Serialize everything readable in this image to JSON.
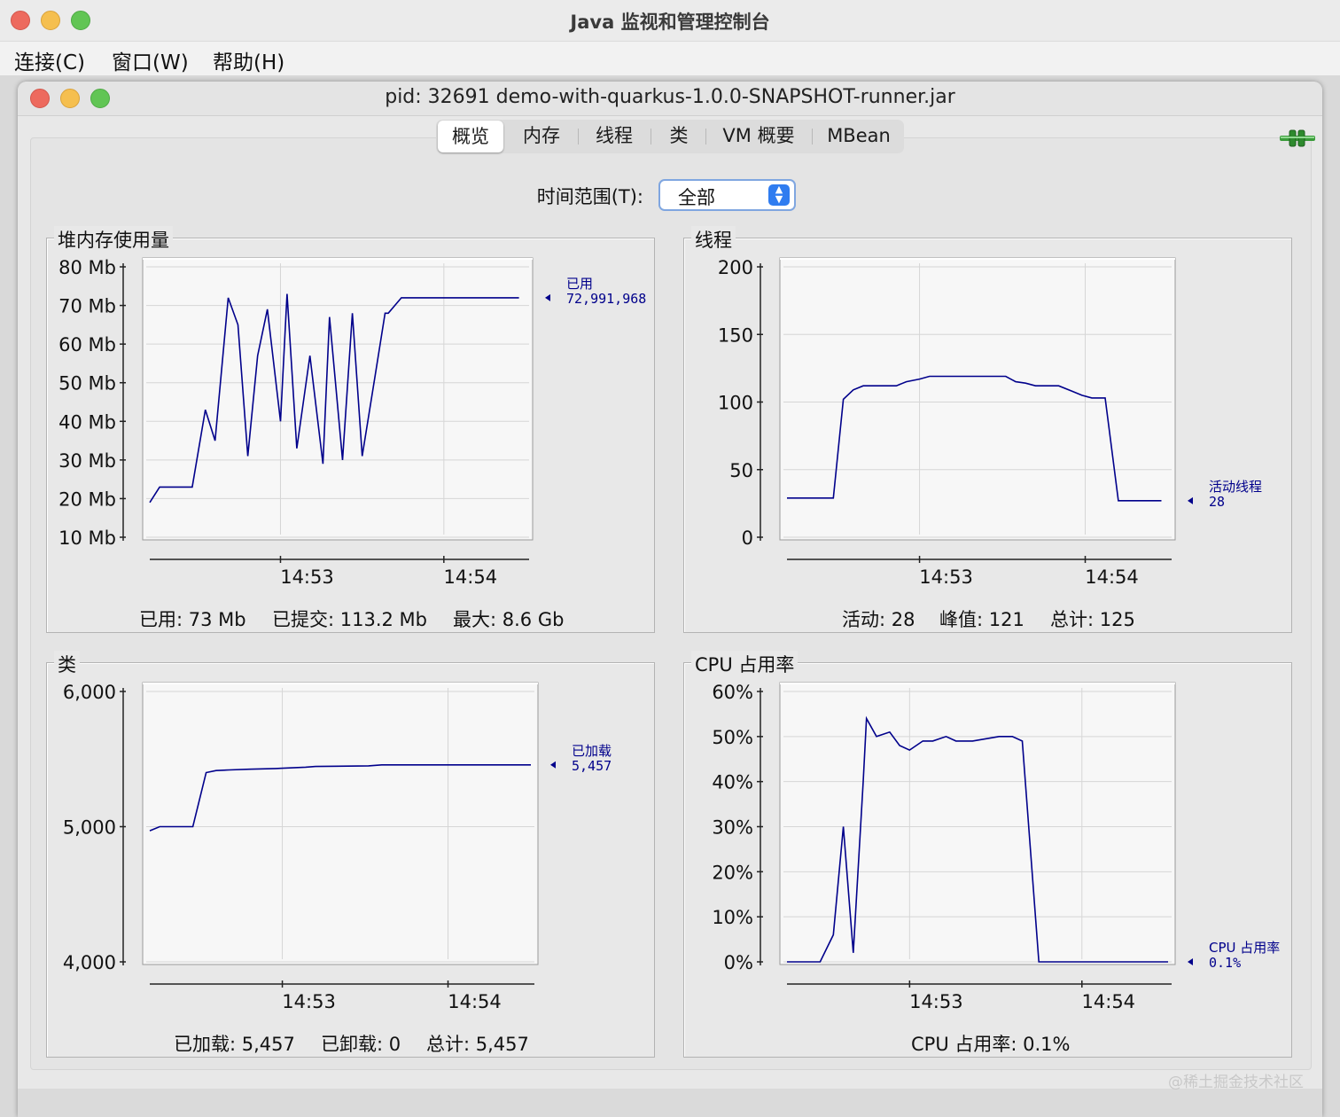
{
  "window": {
    "app_title": "Java 监视和管理控制台",
    "inner_title": "pid: 32691 demo-with-quarkus-1.0.0-SNAPSHOT-runner.jar"
  },
  "menubar": {
    "items": [
      "连接(C)",
      "窗口(W)",
      "帮助(H)"
    ]
  },
  "tabs": [
    {
      "label": "概览",
      "active": true
    },
    {
      "label": "内存",
      "active": false
    },
    {
      "label": "线程",
      "active": false
    },
    {
      "label": "类",
      "active": false
    },
    {
      "label": "VM 概要",
      "active": false
    },
    {
      "label": "MBean",
      "active": false
    }
  ],
  "time_range": {
    "label": "时间范围(T):",
    "value": "全部"
  },
  "icons": {
    "connection": "connection-plug-icon",
    "select_stepper": "stepper-arrows-icon"
  },
  "colors": {
    "series": "#00008b",
    "accent": "#2f7cf0"
  },
  "panels": {
    "heap": {
      "title": "堆内存使用量",
      "summary": [
        "已用: 73 Mb",
        "已提交: 113.2 Mb",
        "最大: 8.6 Gb"
      ]
    },
    "threads": {
      "title": "线程",
      "summary": [
        "活动: 28",
        "峰值: 121",
        "总计: 125"
      ]
    },
    "classes": {
      "title": "类",
      "summary": [
        "已加载: 5,457",
        "已卸载: 0",
        "总计: 5,457"
      ]
    },
    "cpu": {
      "title": "CPU 占用率",
      "summary": [
        "CPU 占用率: 0.1%"
      ]
    }
  },
  "watermark": "@稀土掘金技术社区",
  "chart_data": [
    {
      "id": "heap",
      "type": "line",
      "title": "堆内存使用量",
      "ylim": [
        10,
        80
      ],
      "yticks": [
        10,
        20,
        30,
        40,
        50,
        60,
        70,
        80
      ],
      "ytick_labels": [
        "10 Mb",
        "20 Mb",
        "30 Mb",
        "40 Mb",
        "50 Mb",
        "60 Mb",
        "70 Mb",
        "80 Mb"
      ],
      "xlim": [
        0,
        115
      ],
      "xticks": [
        40,
        90
      ],
      "xtick_labels": [
        "14:53",
        "14:54"
      ],
      "grid": true,
      "legend": {
        "name": "已用",
        "value": "72,991,968"
      },
      "series": [
        {
          "name": "已用",
          "x": [
            0,
            3,
            13,
            17,
            20,
            24,
            27,
            30,
            33,
            36,
            40,
            42,
            45,
            49,
            53,
            55,
            59,
            62,
            65,
            69,
            72,
            73,
            77,
            80,
            84,
            90,
            100,
            113
          ],
          "y": [
            19,
            23,
            23,
            43,
            35,
            72,
            65,
            31,
            57,
            69,
            40,
            73,
            33,
            57,
            29,
            67,
            30,
            68,
            31,
            52,
            68,
            68,
            72,
            72,
            72,
            72,
            72,
            72
          ]
        }
      ]
    },
    {
      "id": "threads",
      "type": "line",
      "title": "线程",
      "ylim": [
        0,
        200
      ],
      "yticks": [
        0,
        50,
        100,
        150,
        200
      ],
      "ytick_labels": [
        "0",
        "50",
        "100",
        "150",
        "200"
      ],
      "xlim": [
        0,
        115
      ],
      "xticks": [
        40,
        90
      ],
      "xtick_labels": [
        "14:53",
        "14:54"
      ],
      "grid": true,
      "legend": {
        "name": "活动线程",
        "value": "28"
      },
      "series": [
        {
          "name": "活动线程",
          "x": [
            0,
            14,
            17,
            20,
            23,
            33,
            36,
            40,
            43,
            66,
            69,
            72,
            75,
            82,
            86,
            89,
            92,
            96,
            100,
            113
          ],
          "y": [
            29,
            29,
            102,
            109,
            112,
            112,
            115,
            117,
            119,
            119,
            115,
            114,
            112,
            112,
            108,
            105,
            103,
            103,
            27,
            27
          ]
        }
      ]
    },
    {
      "id": "classes",
      "type": "line",
      "title": "类",
      "ylim": [
        4000,
        6000
      ],
      "yticks": [
        4000,
        5000,
        6000
      ],
      "ytick_labels": [
        "4,000",
        "5,000",
        "6,000"
      ],
      "xlim": [
        0,
        115
      ],
      "xticks": [
        40,
        90
      ],
      "xtick_labels": [
        "14:53",
        "14:54"
      ],
      "grid": true,
      "legend": {
        "name": "已加载",
        "value": "5,457"
      },
      "series": [
        {
          "name": "已加载",
          "x": [
            0,
            3,
            13,
            17,
            20,
            24,
            30,
            38,
            40,
            47,
            50,
            66,
            70,
            115
          ],
          "y": [
            4970,
            5000,
            5000,
            5400,
            5415,
            5420,
            5425,
            5430,
            5432,
            5440,
            5445,
            5450,
            5457,
            5457
          ]
        }
      ]
    },
    {
      "id": "cpu",
      "type": "line",
      "title": "CPU 占用率",
      "ylim": [
        0,
        60
      ],
      "yticks": [
        0,
        10,
        20,
        30,
        40,
        50,
        60
      ],
      "ytick_labels": [
        "0%",
        "10%",
        "20%",
        "30%",
        "40%",
        "50%",
        "60%"
      ],
      "xlim": [
        0,
        115
      ],
      "xticks": [
        37,
        89
      ],
      "xtick_labels": [
        "14:53",
        "14:54"
      ],
      "grid": true,
      "legend": {
        "name": "CPU 占用率",
        "value": "0.1%"
      },
      "series": [
        {
          "name": "CPU 占用率",
          "x": [
            0,
            10,
            14,
            17,
            20,
            23,
            24,
            27,
            31,
            34,
            37,
            41,
            44,
            48,
            51,
            56,
            64,
            68,
            71,
            76,
            115
          ],
          "y": [
            0,
            0,
            6,
            30,
            2,
            40,
            54,
            50,
            51,
            48,
            47,
            49,
            49,
            50,
            49,
            49,
            50,
            50,
            49,
            0,
            0
          ]
        }
      ]
    }
  ]
}
